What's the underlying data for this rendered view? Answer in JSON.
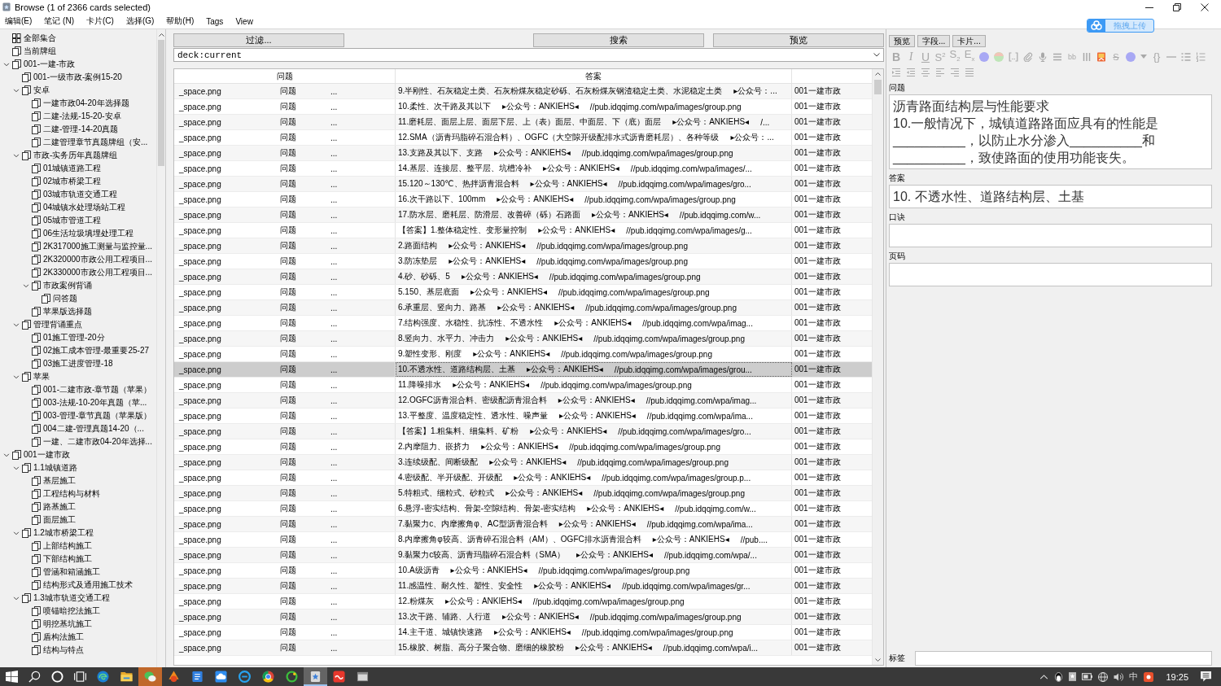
{
  "window": {
    "title": "Browse (1 of 2366 cards selected)"
  },
  "menu": [
    "编辑(E)",
    "笔记 (N)",
    "卡片(C)",
    "选择(G)",
    "帮助(H)",
    "Tags",
    "View"
  ],
  "upload_button": {
    "label": "拖拽上传"
  },
  "sidebar": {
    "items": [
      {
        "label": "全部集合",
        "kind": "collection"
      },
      {
        "label": "当前牌组",
        "kind": "deck"
      },
      {
        "label": "001-一建-市政",
        "kind": "deck",
        "expanded": true,
        "children": [
          {
            "label": "001-一级市政-案例15-20"
          },
          {
            "label": "安卓",
            "expanded": true,
            "children": [
              {
                "label": "一建市政04-20年选择题"
              },
              {
                "label": "二建-法规-15-20-安卓"
              },
              {
                "label": "二建-管理-14-20真题"
              },
              {
                "label": "二建管理章节真题牌组（安..."
              }
            ]
          },
          {
            "label": "市政-实务历年真题牌组",
            "expanded": true,
            "children": [
              {
                "label": "01城镇道路工程"
              },
              {
                "label": "02城市桥梁工程"
              },
              {
                "label": "03城市轨道交通工程"
              },
              {
                "label": "04城镇水处理场站工程"
              },
              {
                "label": "05城市管道工程"
              },
              {
                "label": "06生活垃圾填埋处理工程"
              },
              {
                "label": "2K317000施工测量与监控量..."
              },
              {
                "label": "2K320000市政公用工程项目..."
              },
              {
                "label": "2K330000市政公用工程项目..."
              },
              {
                "label": "市政案例背诵",
                "expanded": true,
                "children": [
                  {
                    "label": "问答题"
                  }
                ]
              },
              {
                "label": "苹果版选择题"
              }
            ]
          },
          {
            "label": "管理背诵重点",
            "expanded": true,
            "children": [
              {
                "label": "01施工管理-20分"
              },
              {
                "label": "02施工成本管理-最重要25-27"
              },
              {
                "label": "03施工进度管理-18"
              }
            ]
          },
          {
            "label": "苹果",
            "expanded": true,
            "children": [
              {
                "label": "001-二建市政-章节题（苹果）"
              },
              {
                "label": "003-法规-10-20年真题（苹..."
              },
              {
                "label": "003-管理-章节真题（苹果版）"
              },
              {
                "label": "004二建-管理真题14-20（..."
              },
              {
                "label": "一建、二建市政04-20年选择..."
              }
            ]
          }
        ]
      },
      {
        "label": "001一建市政",
        "kind": "deck",
        "expanded": true,
        "children": [
          {
            "label": "1.1城镇道路",
            "expanded": true,
            "children": [
              {
                "label": "基层施工"
              },
              {
                "label": "工程结构与材料"
              },
              {
                "label": "路基施工"
              },
              {
                "label": "面层施工"
              }
            ]
          },
          {
            "label": "1.2城市桥梁工程",
            "expanded": true,
            "children": [
              {
                "label": "上部结构施工"
              },
              {
                "label": "下部结构施工"
              },
              {
                "label": "管涵和箱涵施工"
              },
              {
                "label": "结构形式及通用施工技术"
              }
            ]
          },
          {
            "label": "1.3城市轨道交通工程",
            "expanded": true,
            "children": [
              {
                "label": "喷锚暗挖法施工"
              },
              {
                "label": "明挖基坑施工"
              },
              {
                "label": "盾构法施工"
              },
              {
                "label": "结构与特点"
              }
            ]
          }
        ]
      }
    ]
  },
  "browser": {
    "filter_button": "过滤...",
    "search_button": "搜索",
    "preview_button": "预览",
    "search": {
      "value": "deck:current"
    }
  },
  "table": {
    "columns": [
      "问题",
      "答案"
    ],
    "rows": [
      {
        "question": [
          "_space.png",
          "问题",
          "..."
        ],
        "answer": [
          "9.半刚性、石灰稳定土类、石灰粉煤灰稳定砂砾、石灰粉煤灰钢渣稳定土类、水泥稳定土类",
          "▸公众号：..."
        ],
        "deck": "001一建市政",
        "selected": false
      },
      {
        "question": [
          "_space.png",
          "问题",
          "..."
        ],
        "answer": [
          "10.柔性、次干路及其以下",
          "▸公众号：ANKIEHS◂",
          "//pub.idqqimg.com/wpa/images/group.png"
        ],
        "deck": "001一建市政",
        "selected": false
      },
      {
        "question": [
          "_space.png",
          "问题",
          "..."
        ],
        "answer": [
          "11.磨耗层、面层上层、面层下层、上（表）面层、中面层、下（底）面层",
          "▸公众号：ANKIEHS◂",
          "/..."
        ],
        "deck": "001一建市政",
        "selected": false
      },
      {
        "question": [
          "_space.png",
          "问题",
          "..."
        ],
        "answer": [
          "12.SMA（沥青玛脂碎石混合料）、OGFC（大空隙开级配排水式沥青磨耗层）、各种等级",
          "▸公众号：..."
        ],
        "deck": "001一建市政",
        "selected": false
      },
      {
        "question": [
          "_space.png",
          "问题",
          "..."
        ],
        "answer": [
          "13.支路及其以下、支路",
          "▸公众号：ANKIEHS◂",
          "//pub.idqqimg.com/wpa/images/group.png"
        ],
        "deck": "001一建市政",
        "selected": false
      },
      {
        "question": [
          "_space.png",
          "问题",
          "..."
        ],
        "answer": [
          "14.基层、连接层、整平层、坑槽冷补",
          "▸公众号：ANKIEHS◂",
          "//pub.idqqimg.com/wpa/images/..."
        ],
        "deck": "001一建市政",
        "selected": false
      },
      {
        "question": [
          "_space.png",
          "问题",
          "..."
        ],
        "answer": [
          "15.120～130℃、热拌沥青混合料",
          "▸公众号：ANKIEHS◂",
          "//pub.idqqimg.com/wpa/images/gro..."
        ],
        "deck": "001一建市政",
        "selected": false
      },
      {
        "question": [
          "_space.png",
          "问题",
          "..."
        ],
        "answer": [
          "16.次干路以下、100mm",
          "▸公众号：ANKIEHS◂",
          "//pub.idqqimg.com/wpa/images/group.png"
        ],
        "deck": "001一建市政",
        "selected": false
      },
      {
        "question": [
          "_space.png",
          "问题",
          "..."
        ],
        "answer": [
          "17.防水层、磨耗层、防滑层、改善碎（砾）石路面",
          "▸公众号：ANKIEHS◂",
          "//pub.idqqimg.com/w..."
        ],
        "deck": "001一建市政",
        "selected": false
      },
      {
        "question": [
          "_space.png",
          "问题",
          "..."
        ],
        "answer": [
          "【答案】1.整体稳定性、变形量控制",
          "▸公众号：ANKIEHS◂",
          "//pub.idqqimg.com/wpa/images/g..."
        ],
        "deck": "001一建市政",
        "selected": false
      },
      {
        "question": [
          "_space.png",
          "问题",
          "..."
        ],
        "answer": [
          "2.路面结构",
          "▸公众号：ANKIEHS◂",
          "//pub.idqqimg.com/wpa/images/group.png"
        ],
        "deck": "001一建市政",
        "selected": false
      },
      {
        "question": [
          "_space.png",
          "问题",
          "..."
        ],
        "answer": [
          "3.防冻垫层",
          "▸公众号：ANKIEHS◂",
          "//pub.idqqimg.com/wpa/images/group.png"
        ],
        "deck": "001一建市政",
        "selected": false
      },
      {
        "question": [
          "_space.png",
          "问题",
          "..."
        ],
        "answer": [
          "4.砂、砂砾、5",
          "▸公众号：ANKIEHS◂",
          "//pub.idqqimg.com/wpa/images/group.png"
        ],
        "deck": "001一建市政",
        "selected": false
      },
      {
        "question": [
          "_space.png",
          "问题",
          "..."
        ],
        "answer": [
          "5.150、基层底面",
          "▸公众号：ANKIEHS◂",
          "//pub.idqqimg.com/wpa/images/group.png"
        ],
        "deck": "001一建市政",
        "selected": false
      },
      {
        "question": [
          "_space.png",
          "问题",
          "..."
        ],
        "answer": [
          "6.承重层、竖向力、路基",
          "▸公众号：ANKIEHS◂",
          "//pub.idqqimg.com/wpa/images/group.png"
        ],
        "deck": "001一建市政",
        "selected": false
      },
      {
        "question": [
          "_space.png",
          "问题",
          "..."
        ],
        "answer": [
          "7.结构强度、水稳性、抗冻性、不透水性",
          "▸公众号：ANKIEHS◂",
          "//pub.idqqimg.com/wpa/imag..."
        ],
        "deck": "001一建市政",
        "selected": false
      },
      {
        "question": [
          "_space.png",
          "问题",
          "..."
        ],
        "answer": [
          "8.竖向力、水平力、冲击力",
          "▸公众号：ANKIEHS◂",
          "//pub.idqqimg.com/wpa/images/group.png"
        ],
        "deck": "001一建市政",
        "selected": false
      },
      {
        "question": [
          "_space.png",
          "问题",
          "..."
        ],
        "answer": [
          "9.塑性变形、刚度",
          "▸公众号：ANKIEHS◂",
          "//pub.idqqimg.com/wpa/images/group.png"
        ],
        "deck": "001一建市政",
        "selected": false
      },
      {
        "question": [
          "_space.png",
          "问题",
          "..."
        ],
        "answer": [
          "10.不透水性、道路结构层、土基",
          "▸公众号：ANKIEHS◂",
          "//pub.idqqimg.com/wpa/images/grou..."
        ],
        "deck": "001一建市政",
        "selected": true
      },
      {
        "question": [
          "_space.png",
          "问题",
          "..."
        ],
        "answer": [
          "11.降噪排水",
          "▸公众号：ANKIEHS◂",
          "//pub.idqqimg.com/wpa/images/group.png"
        ],
        "deck": "001一建市政",
        "selected": false
      },
      {
        "question": [
          "_space.png",
          "问题",
          "..."
        ],
        "answer": [
          "12.OGFC沥青混合料、密级配沥青混合料",
          "▸公众号：ANKIEHS◂",
          "//pub.idqqimg.com/wpa/imag..."
        ],
        "deck": "001一建市政",
        "selected": false
      },
      {
        "question": [
          "_space.png",
          "问题",
          "..."
        ],
        "answer": [
          "13.平整度、温度稳定性、透水性、噪声量",
          "▸公众号：ANKIEHS◂",
          "//pub.idqqimg.com/wpa/ima..."
        ],
        "deck": "001一建市政",
        "selected": false
      },
      {
        "question": [
          "_space.png",
          "问题",
          "..."
        ],
        "answer": [
          "【答案】1.粗集料、细集料、矿粉",
          "▸公众号：ANKIEHS◂",
          "//pub.idqqimg.com/wpa/images/gro..."
        ],
        "deck": "001一建市政",
        "selected": false
      },
      {
        "question": [
          "_space.png",
          "问题",
          "..."
        ],
        "answer": [
          "2.内摩阻力、嵌挤力",
          "▸公众号：ANKIEHS◂",
          "//pub.idqqimg.com/wpa/images/group.png"
        ],
        "deck": "001一建市政",
        "selected": false
      },
      {
        "question": [
          "_space.png",
          "问题",
          "..."
        ],
        "answer": [
          "3.连续级配、间断级配",
          "▸公众号：ANKIEHS◂",
          "//pub.idqqimg.com/wpa/images/group.png"
        ],
        "deck": "001一建市政",
        "selected": false
      },
      {
        "question": [
          "_space.png",
          "问题",
          "..."
        ],
        "answer": [
          "4.密级配、半开级配、开级配",
          "▸公众号：ANKIEHS◂",
          "//pub.idqqimg.com/wpa/images/group.p..."
        ],
        "deck": "001一建市政",
        "selected": false
      },
      {
        "question": [
          "_space.png",
          "问题",
          "..."
        ],
        "answer": [
          "5.特粗式、细粒式、砂粒式",
          "▸公众号：ANKIEHS◂",
          "//pub.idqqimg.com/wpa/images/group.png"
        ],
        "deck": "001一建市政",
        "selected": false
      },
      {
        "question": [
          "_space.png",
          "问题",
          "..."
        ],
        "answer": [
          "6.悬浮-密实结构、骨架-空隙结构、骨架-密实结构",
          "▸公众号：ANKIEHS◂",
          "//pub.idqqimg.com/w..."
        ],
        "deck": "001一建市政",
        "selected": false
      },
      {
        "question": [
          "_space.png",
          "问题",
          "..."
        ],
        "answer": [
          "7.黏聚力c、内摩擦角φ、AC型沥青混合料",
          "▸公众号：ANKIEHS◂",
          "//pub.idqqimg.com/wpa/ima..."
        ],
        "deck": "001一建市政",
        "selected": false
      },
      {
        "question": [
          "_space.png",
          "问题",
          "..."
        ],
        "answer": [
          "8.内摩擦角φ较高、沥青碎石混合料（AM）、OGFC排水沥青混合料",
          "▸公众号：ANKIEHS◂",
          "//pub...."
        ],
        "deck": "001一建市政",
        "selected": false
      },
      {
        "question": [
          "_space.png",
          "问题",
          "..."
        ],
        "answer": [
          "9.黏聚力c较高、沥青玛脂碎石混合料（SMA）",
          "▸公众号：ANKIEHS◂",
          "//pub.idqqimg.com/wpa/..."
        ],
        "deck": "001一建市政",
        "selected": false
      },
      {
        "question": [
          "_space.png",
          "问题",
          "..."
        ],
        "answer": [
          "10.A级沥青",
          "▸公众号：ANKIEHS◂",
          "//pub.idqqimg.com/wpa/images/group.png"
        ],
        "deck": "001一建市政",
        "selected": false
      },
      {
        "question": [
          "_space.png",
          "问题",
          "..."
        ],
        "answer": [
          "11.感温性、耐久性、塑性、安全性",
          "▸公众号：ANKIEHS◂",
          "//pub.idqqimg.com/wpa/images/gr..."
        ],
        "deck": "001一建市政",
        "selected": false
      },
      {
        "question": [
          "_space.png",
          "问题",
          "..."
        ],
        "answer": [
          "12.粉煤灰",
          "▸公众号：ANKIEHS◂",
          "//pub.idqqimg.com/wpa/images/group.png"
        ],
        "deck": "001一建市政",
        "selected": false
      },
      {
        "question": [
          "_space.png",
          "问题",
          "..."
        ],
        "answer": [
          "13.次干路、辅路、人行道",
          "▸公众号：ANKIEHS◂",
          "//pub.idqqimg.com/wpa/images/group.png"
        ],
        "deck": "001一建市政",
        "selected": false
      },
      {
        "question": [
          "_space.png",
          "问题",
          "..."
        ],
        "answer": [
          "14.主干道、城镇快速路",
          "▸公众号：ANKIEHS◂",
          "//pub.idqqimg.com/wpa/images/group.png"
        ],
        "deck": "001一建市政",
        "selected": false
      },
      {
        "question": [
          "_space.png",
          "问题",
          "..."
        ],
        "answer": [
          "15.橡胶、树脂、高分子聚合物、磨细的橡胶粉",
          "▸公众号：ANKIEHS◂",
          "//pub.idqqimg.com/wpa/i..."
        ],
        "deck": "001一建市政",
        "selected": false
      }
    ]
  },
  "editor": {
    "buttons": [
      "预览",
      "字段...",
      "卡片..."
    ],
    "toolbar": [
      {
        "kind": "bold",
        "text": "B"
      },
      {
        "kind": "italic",
        "text": "I"
      },
      {
        "kind": "underline",
        "text": "U"
      },
      {
        "kind": "text",
        "text": "S$^{2}$"
      },
      {
        "kind": "text",
        "text": "S$_{2}$"
      },
      {
        "kind": "text",
        "text": "E$_{x}$"
      },
      {
        "kind": "icon"
      },
      {
        "kind": "icon"
      },
      {
        "kind": "icon"
      },
      {
        "kind": "icon"
      },
      {
        "kind": "icon"
      },
      {
        "kind": "icon"
      },
      {
        "kind": "small",
        "text": "bb"
      },
      {
        "kind": "icon"
      },
      {
        "kind": "icon"
      },
      {
        "kind": "strike",
        "text": "S"
      },
      {
        "kind": "icon"
      },
      {
        "kind": "icon"
      },
      {
        "kind": "text",
        "text": "{}"
      },
      {
        "kind": "icon"
      },
      {
        "kind": "icon"
      },
      {
        "kind": "icon"
      }
    ],
    "fields": [
      {
        "label": "问题",
        "value": "沥青路面结构层与性能要求\n10.一般情况下，城镇道路路面应具有的性能是\n__________，以防止水分渗入__________和\n__________，致使路面的使用功能丧失。"
      },
      {
        "label": "答案",
        "value": "10. 不透水性、道路结构层、土基"
      },
      {
        "label": "口诀"
      },
      {
        "label": "页码"
      }
    ],
    "tags": {
      "label": "标签"
    }
  },
  "taskbar": {
    "apps": [
      {
        "selected": false,
        "flashing": false
      },
      {
        "selected": false,
        "flashing": false
      },
      {
        "selected": false,
        "flashing": true
      },
      {
        "selected": false,
        "flashing": false
      },
      {
        "selected": false,
        "flashing": false
      },
      {
        "selected": false,
        "flashing": false
      },
      {
        "selected": false,
        "flashing": false
      },
      {
        "selected": false,
        "flashing": false
      },
      {
        "selected": false,
        "flashing": false
      },
      {
        "selected": true,
        "flashing": false
      },
      {
        "selected": false,
        "flashing": false
      },
      {
        "selected": false,
        "flashing": false
      }
    ],
    "ime": "中",
    "clock": "19:25"
  }
}
